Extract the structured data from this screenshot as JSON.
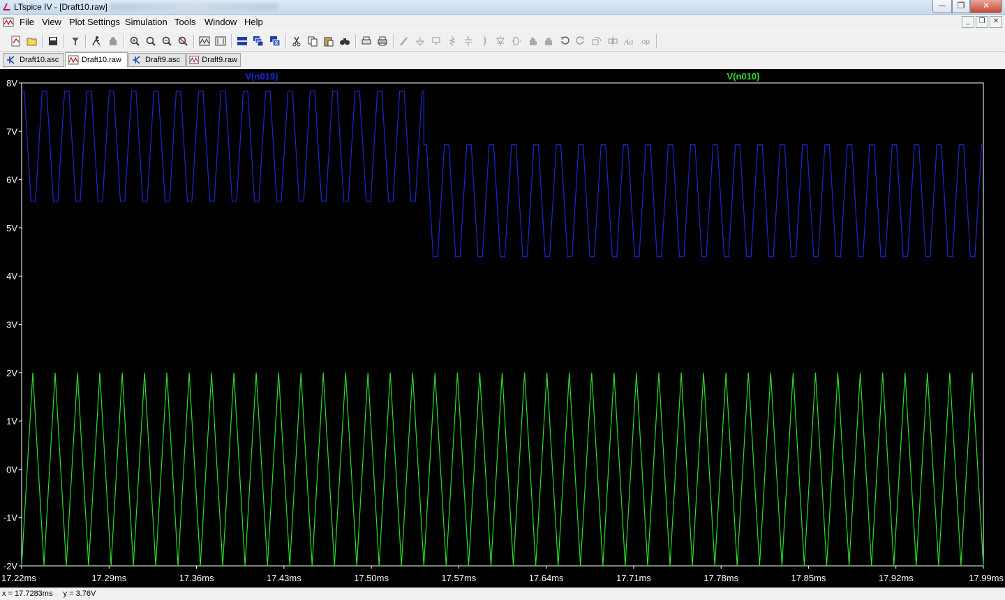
{
  "window": {
    "title": "LTspice IV - [Draft10.raw]",
    "controls": {
      "minimize": "─",
      "maximize": "❐",
      "close": "✕"
    }
  },
  "menu": {
    "items": [
      "File",
      "View",
      "Plot Settings",
      "Simulation",
      "Tools",
      "Window",
      "Help"
    ],
    "mdi_controls": {
      "minimize": "_",
      "restore": "❐",
      "close": "✕"
    }
  },
  "toolbar": {
    "icons": [
      "new-schematic-icon",
      "open-icon",
      "save-icon",
      "control-panel-icon",
      "run-icon",
      "halt-icon",
      "zoom-in-icon",
      "zoom-full-icon",
      "zoom-out-icon",
      "zoom-cancel-icon",
      "autorange-icon",
      "zoom-extents-icon",
      "tile-horizontal-icon",
      "cascade-icon",
      "close-all-icon",
      "cut-icon",
      "copy-icon",
      "paste-icon",
      "find-icon",
      "print-preview-icon",
      "print-icon",
      "wire-icon",
      "ground-icon",
      "label-icon",
      "resistor-icon",
      "capacitor-icon",
      "inductor-icon",
      "diode-icon",
      "component-icon",
      "move-icon",
      "drag-icon",
      "undo-icon",
      "redo-icon",
      "rotate-icon",
      "mirror-icon",
      "text-icon",
      "spice-directive-icon"
    ]
  },
  "tabs": [
    {
      "label": "Draft10.asc",
      "kind": "schematic",
      "active": false
    },
    {
      "label": "Draft10.raw",
      "kind": "waveform",
      "active": true
    },
    {
      "label": "Draft9.asc",
      "kind": "schematic",
      "active": false
    },
    {
      "label": "Draft9.raw",
      "kind": "waveform",
      "active": false
    }
  ],
  "colors": {
    "background": "#000000",
    "axis": "#ffffff",
    "grid": "#3a3a3a",
    "series_blue": "#1e28d8",
    "series_green": "#28e028"
  },
  "chart_data": {
    "type": "line",
    "xunit": "ms",
    "yunit": "V",
    "xlim": [
      17.22,
      17.99
    ],
    "ylim": [
      -2,
      8
    ],
    "x_ticks": [
      "17.22ms",
      "17.29ms",
      "17.36ms",
      "17.43ms",
      "17.50ms",
      "17.57ms",
      "17.64ms",
      "17.71ms",
      "17.78ms",
      "17.85ms",
      "17.92ms",
      "17.99ms"
    ],
    "y_ticks": [
      "8V",
      "7V",
      "6V",
      "5V",
      "4V",
      "3V",
      "2V",
      "1V",
      "0V",
      "-1V",
      "-2V"
    ],
    "grid": false,
    "series": [
      {
        "name": "V(n019)",
        "color": "#1e28d8",
        "segments": [
          {
            "x_start": 17.22,
            "x_end": 17.542,
            "high": 7.83,
            "low": 5.55,
            "cycles": 18,
            "shape": "trapezoid"
          },
          {
            "x_start": 17.542,
            "x_end": 17.99,
            "high": 6.72,
            "low": 4.4,
            "cycles": 25,
            "shape": "trapezoid"
          }
        ]
      },
      {
        "name": "V(n010)",
        "color": "#28e028",
        "segments": [
          {
            "x_start": 17.22,
            "x_end": 17.542,
            "high": 2.0,
            "low": -2.0,
            "cycles": 18,
            "shape": "triangle"
          },
          {
            "x_start": 17.542,
            "x_end": 17.99,
            "high": 2.0,
            "low": -2.0,
            "cycles": 25,
            "shape": "triangle"
          }
        ]
      }
    ]
  },
  "status": {
    "x": "x = 17.7283ms",
    "y": "y = 3.76V"
  }
}
